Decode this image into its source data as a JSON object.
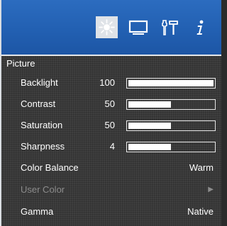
{
  "tabs": [
    {
      "icon": "brightness-icon",
      "active": true
    },
    {
      "icon": "display-icon",
      "active": false
    },
    {
      "icon": "tools-icon",
      "active": false
    },
    {
      "icon": "info-icon",
      "active": false
    }
  ],
  "section_title": "Picture",
  "sliders": [
    {
      "label": "Backlight",
      "value": "100",
      "level": 1.0
    },
    {
      "label": "Contrast",
      "value": "50",
      "level": 0.5
    },
    {
      "label": "Saturation",
      "value": "50",
      "level": 0.5
    },
    {
      "label": "Sharpness",
      "value": "4",
      "level": 0.5
    }
  ],
  "options": [
    {
      "label": "Color Balance",
      "value": "Warm",
      "enabled": true
    },
    {
      "label": "User Color",
      "value": "▶",
      "enabled": false
    },
    {
      "label": "Gamma",
      "value": "Native",
      "enabled": true
    }
  ],
  "colors": {
    "header_blue": "#2260b2",
    "active_tab": "#dfe3e8",
    "disabled_text": "#8c8c8c"
  }
}
